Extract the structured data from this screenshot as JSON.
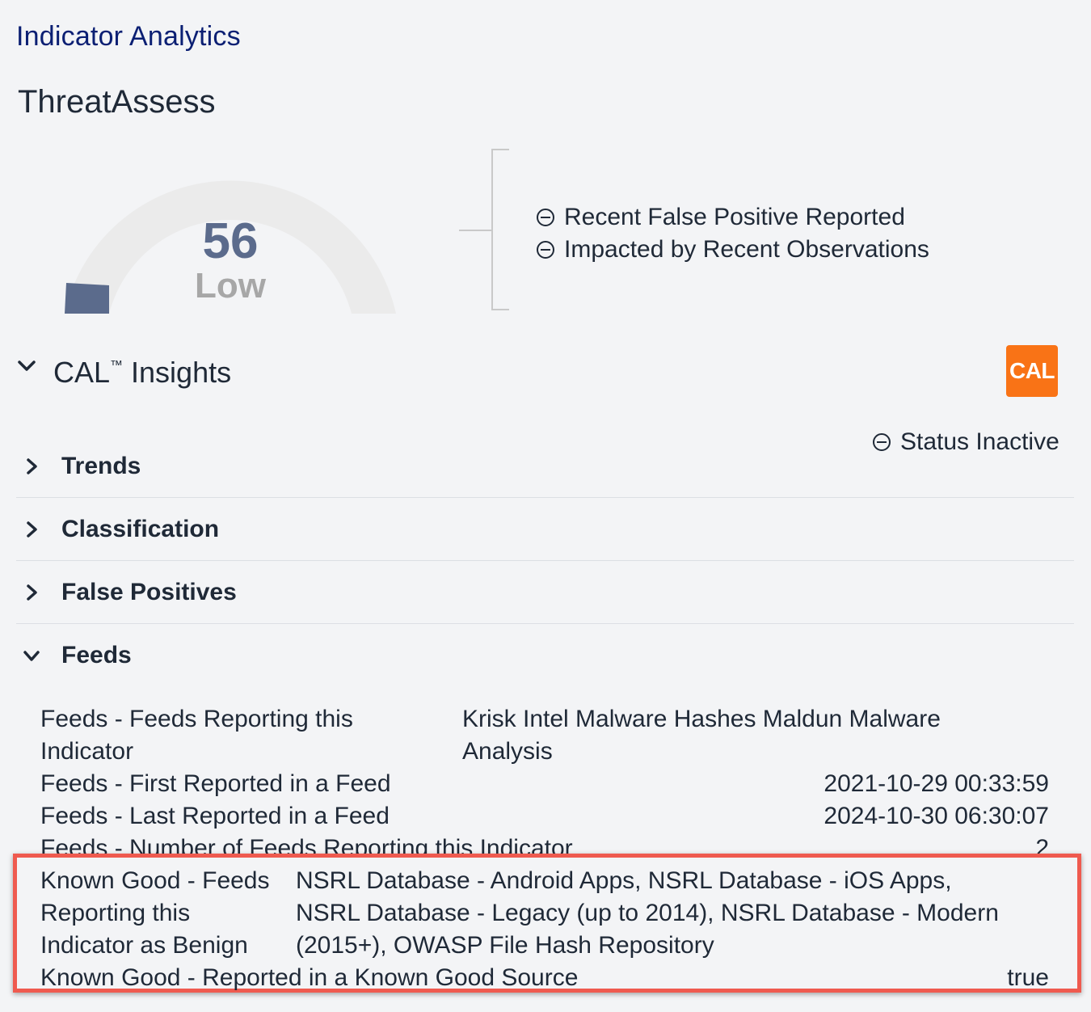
{
  "header": {
    "title": "Indicator Analytics"
  },
  "threat_assess": {
    "title": "ThreatAssess",
    "score": "56",
    "level": "Low",
    "score_fraction": 0.56,
    "factors": [
      {
        "icon": "minus-circle-icon",
        "label": "Recent False Positive Reported"
      },
      {
        "icon": "minus-circle-icon",
        "label": "Impacted by Recent Observations"
      }
    ]
  },
  "cal_insights": {
    "title": "CAL",
    "trademark": "™",
    "title_suffix": " Insights",
    "logo_text": "CAL",
    "status_label": "Status Inactive",
    "sections": [
      {
        "label": "Trends",
        "expanded": false
      },
      {
        "label": "Classification",
        "expanded": false
      },
      {
        "label": "False Positives",
        "expanded": false
      },
      {
        "label": "Feeds",
        "expanded": true
      }
    ]
  },
  "feeds": {
    "reporting_label_line1": "Feeds - Feeds Reporting this",
    "reporting_label_line2": "Indicator",
    "reporting_value_line1": "Krisk Intel Malware Hashes Maldun Malware",
    "reporting_value_line2": "Analysis",
    "first_reported_label": "Feeds - First Reported in a Feed",
    "first_reported_value": "2021-10-29 00:33:59",
    "last_reported_label": "Feeds - Last Reported in a Feed",
    "last_reported_value": "2024-10-30 06:30:07",
    "count_label": "Feeds - Number of Feeds Reporting this Indicator",
    "count_value": "2",
    "known_good_label_line1": "Known Good - Feeds",
    "known_good_label_line2": "Reporting this",
    "known_good_label_line3": "Indicator as Benign",
    "known_good_value_line1": "NSRL Database - Android Apps, NSRL Database - iOS Apps,",
    "known_good_value_line2": "NSRL Database - Legacy (up to 2014), NSRL Database - Modern",
    "known_good_value_line3": "(2015+), OWASP File Hash Repository",
    "known_good_source_label": "Known Good - Reported in a Known Good Source",
    "known_good_source_value": "true"
  },
  "colors": {
    "title_blue": "#0b1f73",
    "gauge_fill": "#5b6b8c",
    "gauge_track": "#ebebeb",
    "cal_orange": "#f97316",
    "highlight_red": "#ef5a4f"
  }
}
